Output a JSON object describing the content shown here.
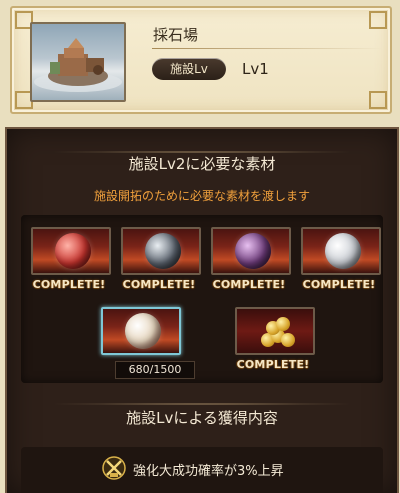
{
  "facility": {
    "name": "採石場",
    "level_badge": "施設Lv",
    "level_value": "Lv1"
  },
  "upgrade": {
    "title": "施設Lv2に必要な素材",
    "subtitle": "施設開拓のために必要な素材を渡します",
    "materials": [
      {
        "status": "COMPLETE!",
        "icon": "red-orb-icon",
        "color": "#c7342e"
      },
      {
        "status": "COMPLETE!",
        "icon": "dark-orb-icon",
        "color": "#5d6570"
      },
      {
        "status": "COMPLETE!",
        "icon": "purple-orb-icon",
        "color": "#6d3b7a"
      },
      {
        "status": "COMPLETE!",
        "icon": "white-orb-icon",
        "color": "#c9cdd3"
      },
      {
        "status": "680/1500",
        "icon": "light-orb-icon",
        "color": "#e7d7c0",
        "progress": 0.453
      },
      {
        "status": "COMPLETE!",
        "icon": "rupie-coins-icon",
        "color": "#d7a42a"
      }
    ]
  },
  "rewards": {
    "title": "施設Lvによる獲得内容",
    "items": [
      {
        "text": "強化大成功確率が3%上昇",
        "icon": "crossed-swords-icon"
      }
    ]
  },
  "colors": {
    "accent_orange": "#f0a03c",
    "panel_dark": "#2e2019",
    "parchment": "#efe3c1"
  }
}
